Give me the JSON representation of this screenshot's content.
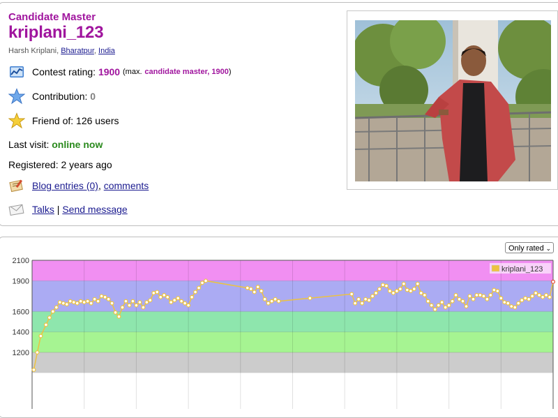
{
  "profile": {
    "rank": "Candidate Master",
    "handle": "kriplani_123",
    "name": "Harsh Kriplani",
    "city": "Bharatpur",
    "country": "India",
    "rating_label": "Contest rating:",
    "rating": "1900",
    "max_prefix": "(max.",
    "max_rank_rating": "candidate master, 1900",
    "max_suffix": ")",
    "contribution_label": "Contribution:",
    "contribution": "0",
    "friend_label": "Friend of: 126 users",
    "last_visit_label": "Last visit:",
    "last_visit": "online now",
    "registered": "Registered: 2 years ago",
    "blog_link": "Blog entries (0)",
    "comments_link": "comments",
    "talks_link": "Talks",
    "send_message_link": "Send message"
  },
  "icons": {
    "rating": "rating-chart-icon",
    "contribution": "star-blue-icon",
    "friend": "star-gold-icon",
    "blog": "blog-icon",
    "talks": "envelope-icon"
  },
  "chart_controls": {
    "filter_selected": "Only rated"
  },
  "chart_data": {
    "type": "line",
    "series": [
      {
        "name": "kriplani_123",
        "color": "#edc240",
        "points": [
          [
            0.5,
            1030
          ],
          [
            1.5,
            1200
          ],
          [
            2.5,
            1360
          ],
          [
            4,
            1470
          ],
          [
            5,
            1540
          ],
          [
            6,
            1600
          ],
          [
            7,
            1640
          ],
          [
            8,
            1690
          ],
          [
            9,
            1680
          ],
          [
            10,
            1670
          ],
          [
            11,
            1700
          ],
          [
            12,
            1690
          ],
          [
            13,
            1680
          ],
          [
            14,
            1700
          ],
          [
            15,
            1690
          ],
          [
            16,
            1700
          ],
          [
            17,
            1680
          ],
          [
            18,
            1720
          ],
          [
            19,
            1700
          ],
          [
            20,
            1750
          ],
          [
            21,
            1740
          ],
          [
            22,
            1720
          ],
          [
            23,
            1680
          ],
          [
            24,
            1590
          ],
          [
            25,
            1550
          ],
          [
            26,
            1640
          ],
          [
            27,
            1700
          ],
          [
            28,
            1660
          ],
          [
            29,
            1700
          ],
          [
            30,
            1660
          ],
          [
            31,
            1690
          ],
          [
            32,
            1640
          ],
          [
            33,
            1690
          ],
          [
            34,
            1710
          ],
          [
            35,
            1780
          ],
          [
            36,
            1790
          ],
          [
            37,
            1740
          ],
          [
            38,
            1760
          ],
          [
            39,
            1740
          ],
          [
            40,
            1690
          ],
          [
            41,
            1710
          ],
          [
            42,
            1730
          ],
          [
            43,
            1700
          ],
          [
            44,
            1680
          ],
          [
            45,
            1660
          ],
          [
            46,
            1740
          ],
          [
            47,
            1790
          ],
          [
            48,
            1830
          ],
          [
            49,
            1880
          ],
          [
            50,
            1900
          ],
          [
            62,
            1830
          ],
          [
            63,
            1820
          ],
          [
            64,
            1790
          ],
          [
            65,
            1840
          ],
          [
            66,
            1800
          ],
          [
            67,
            1720
          ],
          [
            68,
            1680
          ],
          [
            69,
            1700
          ],
          [
            70,
            1720
          ],
          [
            71,
            1700
          ],
          [
            80,
            1730
          ],
          [
            92,
            1770
          ],
          [
            93,
            1680
          ],
          [
            94,
            1720
          ],
          [
            95,
            1680
          ],
          [
            96,
            1720
          ],
          [
            97,
            1710
          ],
          [
            98,
            1750
          ],
          [
            99,
            1780
          ],
          [
            100,
            1820
          ],
          [
            101,
            1860
          ],
          [
            102,
            1850
          ],
          [
            103,
            1800
          ],
          [
            104,
            1780
          ],
          [
            105,
            1800
          ],
          [
            106,
            1820
          ],
          [
            107,
            1870
          ],
          [
            108,
            1810
          ],
          [
            109,
            1800
          ],
          [
            110,
            1820
          ],
          [
            111,
            1870
          ],
          [
            112,
            1780
          ],
          [
            113,
            1760
          ],
          [
            114,
            1700
          ],
          [
            115,
            1660
          ],
          [
            116,
            1620
          ],
          [
            117,
            1660
          ],
          [
            118,
            1690
          ],
          [
            119,
            1640
          ],
          [
            120,
            1660
          ],
          [
            121,
            1700
          ],
          [
            122,
            1760
          ],
          [
            123,
            1720
          ],
          [
            124,
            1700
          ],
          [
            125,
            1650
          ],
          [
            126,
            1750
          ],
          [
            127,
            1720
          ],
          [
            128,
            1760
          ],
          [
            129,
            1760
          ],
          [
            130,
            1750
          ],
          [
            131,
            1720
          ],
          [
            132,
            1760
          ],
          [
            133,
            1810
          ],
          [
            134,
            1800
          ],
          [
            135,
            1730
          ],
          [
            136,
            1690
          ],
          [
            137,
            1680
          ],
          [
            138,
            1650
          ],
          [
            139,
            1640
          ],
          [
            140,
            1680
          ],
          [
            141,
            1710
          ],
          [
            142,
            1730
          ],
          [
            143,
            1720
          ],
          [
            144,
            1750
          ],
          [
            145,
            1780
          ],
          [
            146,
            1760
          ],
          [
            147,
            1740
          ],
          [
            148,
            1760
          ],
          [
            149,
            1740
          ],
          [
            150,
            1890
          ]
        ],
        "last_point_highlight": "#e34a33"
      }
    ],
    "xlim": [
      0,
      150
    ],
    "ylim": [
      1000,
      2100
    ],
    "y_ticks": [
      2100,
      1900,
      1600,
      1400,
      1200
    ],
    "x_grid_count": 10,
    "rank_bands": [
      {
        "from": 1000,
        "to": 1200,
        "color": "#cccccc"
      },
      {
        "from": 1200,
        "to": 1400,
        "color": "#a6f492"
      },
      {
        "from": 1400,
        "to": 1600,
        "color": "#8ee6ad"
      },
      {
        "from": 1600,
        "to": 1900,
        "color": "#ababf3"
      },
      {
        "from": 1900,
        "to": 2100,
        "color": "#f18ff2"
      }
    ],
    "legend_position": "top-right",
    "grid": true
  }
}
